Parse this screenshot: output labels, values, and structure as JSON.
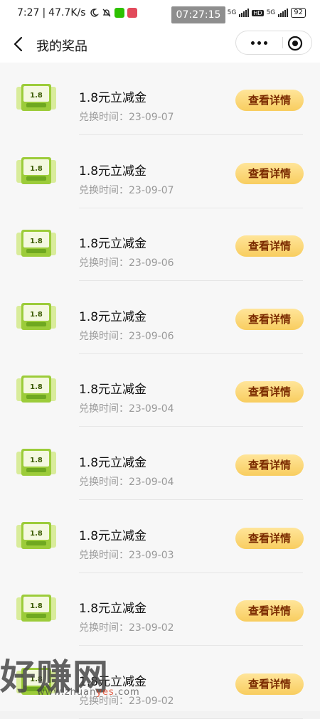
{
  "status_bar": {
    "time": "7:27",
    "net_speed": "47.7K/s",
    "clock_overlay": "07:27:15",
    "battery": "92",
    "net_5g": "5G",
    "hd": "HD"
  },
  "nav": {
    "title": "我的奖品"
  },
  "prizes": [
    {
      "name": "1.8元立减金",
      "date": "兑换时间：23-09-07",
      "button": "查看详情",
      "thumb_value": "1.8"
    },
    {
      "name": "1.8元立减金",
      "date": "兑换时间：23-09-07",
      "button": "查看详情",
      "thumb_value": "1.8"
    },
    {
      "name": "1.8元立减金",
      "date": "兑换时间：23-09-06",
      "button": "查看详情",
      "thumb_value": "1.8"
    },
    {
      "name": "1.8元立减金",
      "date": "兑换时间：23-09-06",
      "button": "查看详情",
      "thumb_value": "1.8"
    },
    {
      "name": "1.8元立减金",
      "date": "兑换时间：23-09-04",
      "button": "查看详情",
      "thumb_value": "1.8"
    },
    {
      "name": "1.8元立减金",
      "date": "兑换时间：23-09-04",
      "button": "查看详情",
      "thumb_value": "1.8"
    },
    {
      "name": "1.8元立减金",
      "date": "兑换时间：23-09-03",
      "button": "查看详情",
      "thumb_value": "1.8"
    },
    {
      "name": "1.8元立减金",
      "date": "兑换时间：23-09-02",
      "button": "查看详情",
      "thumb_value": "1.8"
    },
    {
      "name": "1.8元立减金",
      "date": "兑换时间：23-09-02",
      "button": "查看详情",
      "thumb_value": "1.8"
    }
  ],
  "watermark": {
    "text": "好赚网",
    "url_prefix": "www.zhuan",
    "url_yes": "yes",
    "url_suffix": ".com"
  },
  "colors": {
    "button_top": "#ffe59a",
    "button_bottom": "#f8cd5f",
    "button_text": "#7a2a00",
    "thumb_green": "#9ccc3a"
  }
}
